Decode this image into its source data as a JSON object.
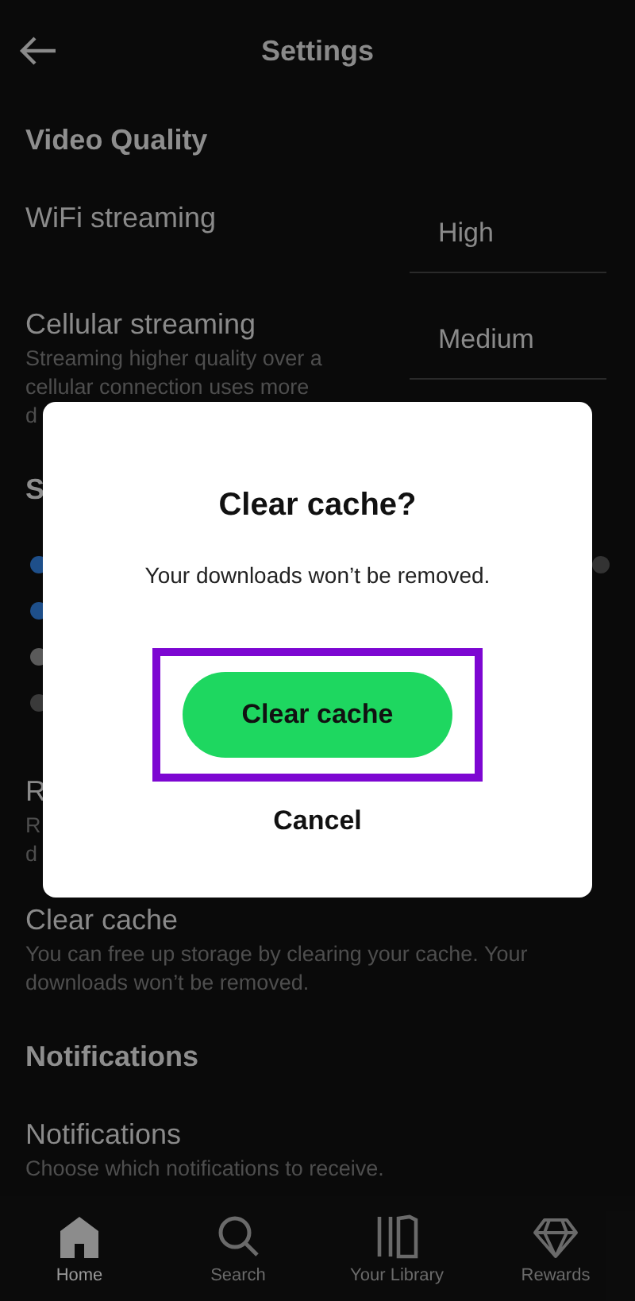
{
  "top_bar": {
    "title": "Settings"
  },
  "rows": [
    {
      "kind": "header",
      "title": "Video Quality"
    },
    {
      "kind": "item",
      "title": "WiFi streaming",
      "value": "High"
    },
    {
      "kind": "item",
      "title": "Cellular streaming",
      "description": [
        "Streaming higher quality over a",
        "cellular connection uses more",
        "d"
      ],
      "value": "Medium"
    },
    {
      "kind": "header",
      "title": "S"
    },
    {
      "kind": "legend",
      "dots": [
        {
          "color": "#1e4f8a"
        },
        {
          "color": "#1e4f8a"
        },
        {
          "color": "#5a5a5a"
        },
        {
          "color": "#3a3a3a"
        }
      ]
    },
    {
      "kind": "item",
      "title": "R",
      "description": [
        "R",
        "d"
      ]
    },
    {
      "kind": "item",
      "title": "Clear cache",
      "description": [
        "You can free up storage by clearing your cache. Your",
        "downloads won’t be removed."
      ]
    },
    {
      "kind": "header",
      "title": "Notifications"
    },
    {
      "kind": "item",
      "title": "Notifications",
      "description": [
        "Choose which notifications to receive."
      ]
    }
  ],
  "dialog": {
    "title": "Clear cache?",
    "message": "Your downloads won’t be removed.",
    "confirm": "Clear cache",
    "cancel": "Cancel",
    "highlighted": true
  },
  "nav": [
    {
      "label": "Home",
      "selected": true
    },
    {
      "label": "Search",
      "selected": false
    },
    {
      "label": "Your Library",
      "selected": false
    },
    {
      "label": "Rewards",
      "selected": false
    }
  ]
}
